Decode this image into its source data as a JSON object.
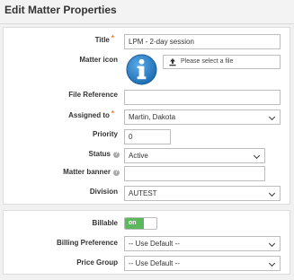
{
  "page": {
    "title": "Edit Matter Properties"
  },
  "form": {
    "title_label": "Title",
    "title_value": "LPM - 2-day session",
    "matter_icon_label": "Matter icon",
    "file_select_text": "Please select a file",
    "file_reference_label": "File Reference",
    "file_reference_value": "",
    "assigned_to_label": "Assigned to",
    "assigned_to_value": "Martin, Dakota",
    "priority_label": "Priority",
    "priority_value": "0",
    "status_label": "Status",
    "status_value": "Active",
    "matter_banner_label": "Matter banner",
    "matter_banner_value": "",
    "division_label": "Division",
    "division_value": "AUTEST"
  },
  "billing": {
    "billable_label": "Billable",
    "billable_toggle": "on",
    "billing_pref_label": "Billing Preference",
    "billing_pref_value": "-- Use Default --",
    "price_group_label": "Price Group",
    "price_group_value": "-- Use Default --"
  },
  "colors": {
    "toggle_on": "#5cb85c",
    "required_asterisk": "#e47c1e",
    "info_icon": "#1f6fb5"
  },
  "icons": {
    "matter_icon": "info-icon",
    "upload": "upload-icon",
    "help": "help-icon"
  }
}
